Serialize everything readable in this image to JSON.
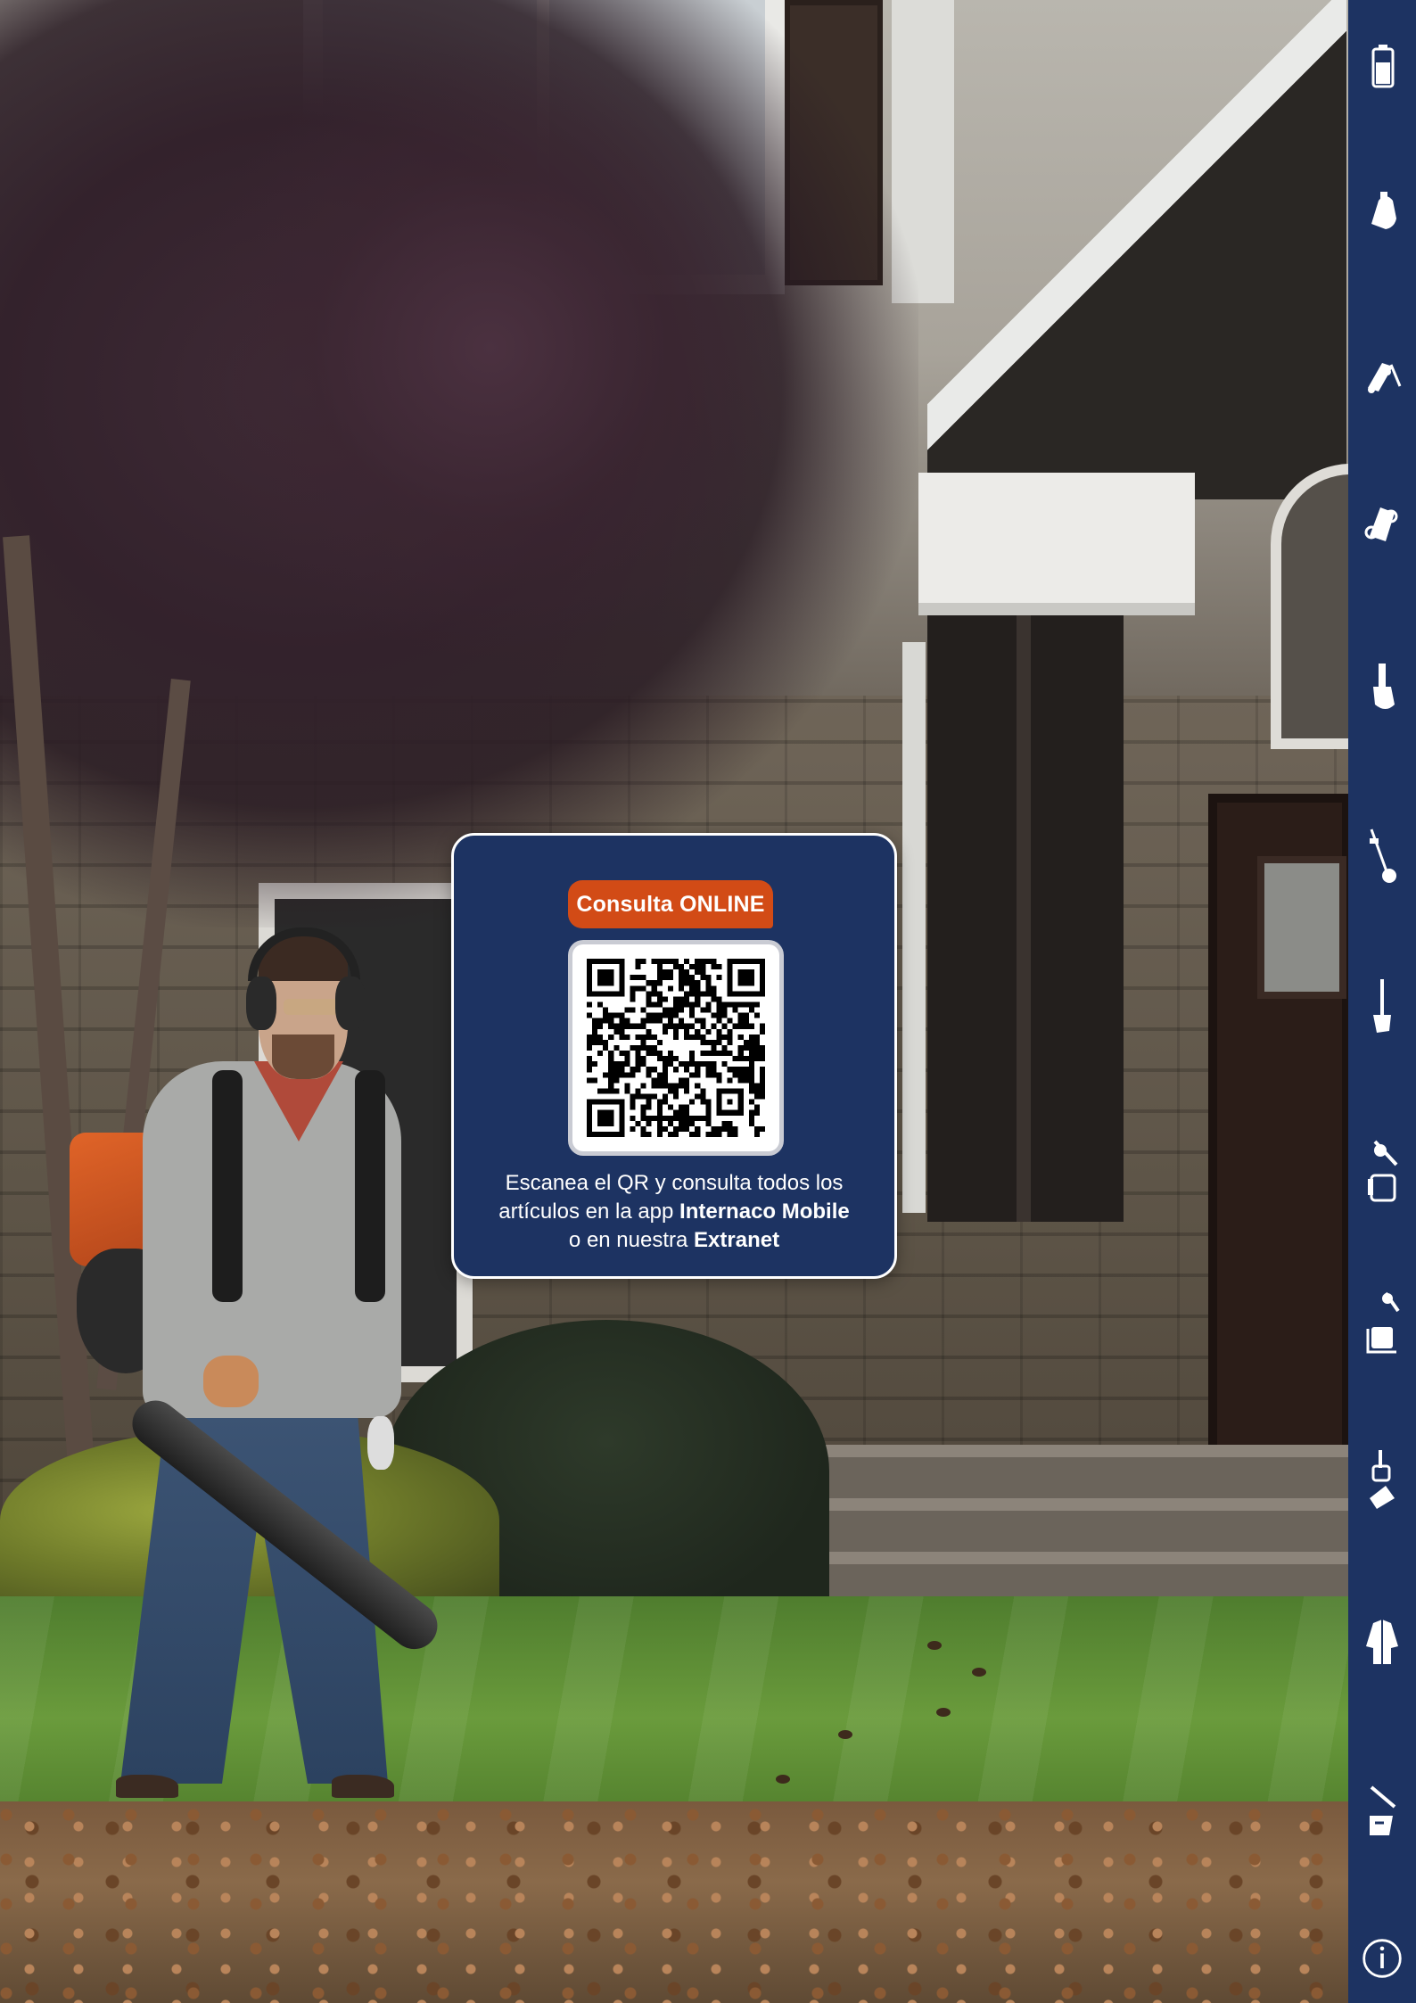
{
  "qr_card": {
    "badge": "Consulta ONLINE",
    "line1": "Escanea el QR y consulta todos los",
    "line2_prefix": "artículos en la app ",
    "line2_bold": "Internaco Mobile",
    "line3_prefix": "o en nuestra ",
    "line3_bold": "Extranet",
    "qr_icon": "qr-code"
  },
  "sidebar": {
    "background": "#1d3362",
    "items": [
      {
        "icon": "battery-icon"
      },
      {
        "icon": "chainsaw-icon"
      },
      {
        "icon": "lawn-mower-icon"
      },
      {
        "icon": "ride-on-mower-icon"
      },
      {
        "icon": "hedge-trimmer-icon"
      },
      {
        "icon": "brush-cutter-icon"
      },
      {
        "icon": "pole-saw-icon"
      },
      {
        "icon": "blower-and-sprayer-icon"
      },
      {
        "icon": "multi-tool-icon"
      },
      {
        "icon": "tiller-icon"
      },
      {
        "icon": "protective-clothing-icon"
      },
      {
        "icon": "accessories-icon"
      },
      {
        "icon": "info-icon"
      }
    ]
  },
  "colors": {
    "navy": "#1d3362",
    "orange": "#d24b16"
  }
}
